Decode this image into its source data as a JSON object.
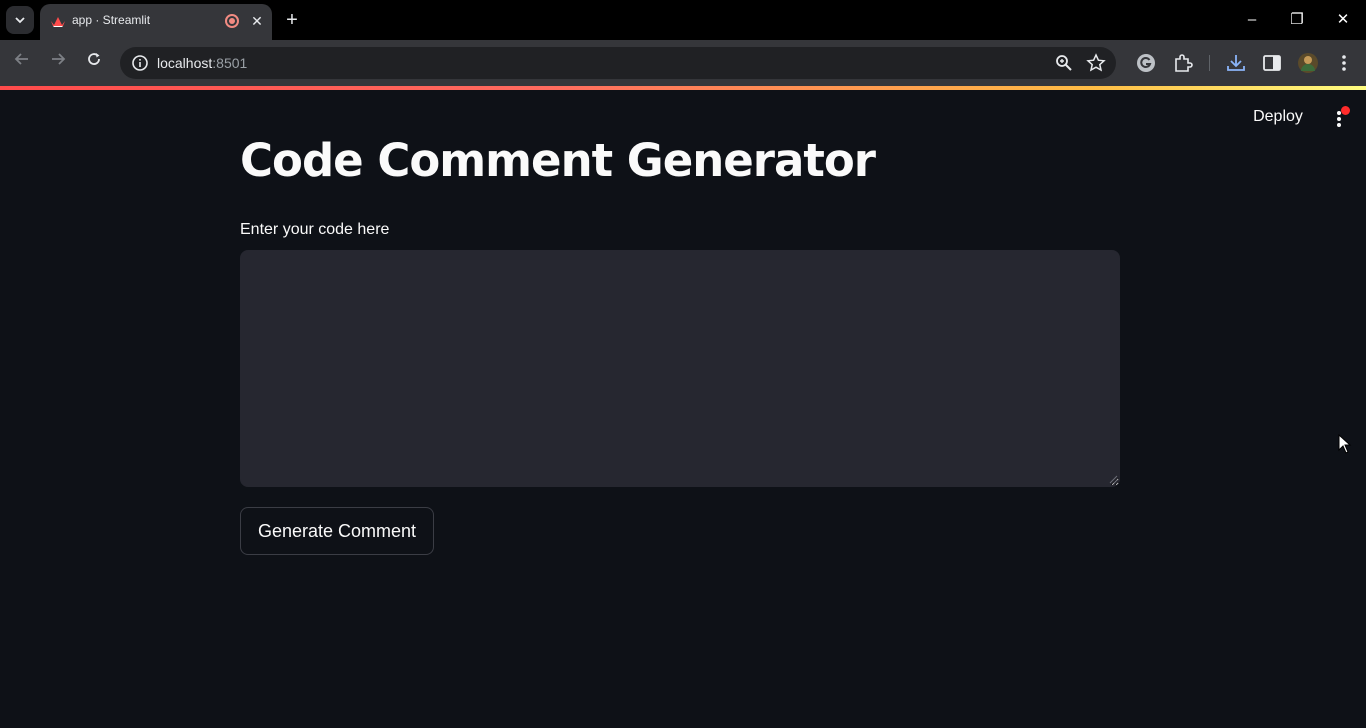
{
  "browser": {
    "tab_title": "app · Streamlit",
    "url_host": "localhost",
    "url_port": ":8501",
    "new_tab_symbol": "+",
    "close_symbol": "✕",
    "window_controls": [
      "–",
      "❐",
      "✕"
    ]
  },
  "app": {
    "deploy_label": "Deploy",
    "title": "Code Comment Generator",
    "input_label": "Enter your code here",
    "input_value": "",
    "button_label": "Generate Comment"
  },
  "colors": {
    "app_bg": "#0e1117",
    "input_bg": "#262730",
    "text": "#fafafa",
    "accent": "#ff4b4b",
    "chrome_bg": "#35363a",
    "titlebar_bg": "#000000"
  }
}
